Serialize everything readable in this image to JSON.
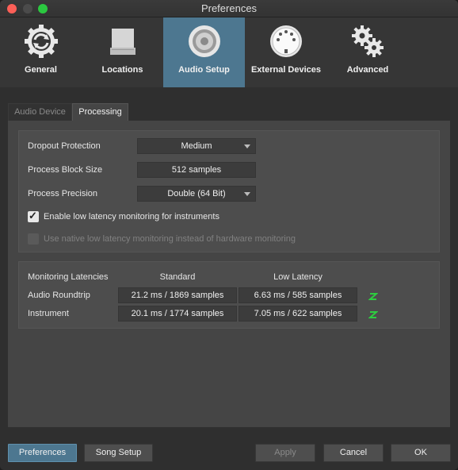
{
  "window": {
    "title": "Preferences"
  },
  "toolbar": {
    "items": [
      {
        "label": "General",
        "icon": "general-sync-icon"
      },
      {
        "label": "Locations",
        "icon": "drive-icon"
      },
      {
        "label": "Audio Setup",
        "icon": "speaker-icon",
        "active": true
      },
      {
        "label": "External Devices",
        "icon": "midi-port-icon"
      },
      {
        "label": "Advanced",
        "icon": "gears-icon"
      }
    ],
    "active_color": "#4d7790"
  },
  "tabs": [
    {
      "label": "Audio Device"
    },
    {
      "label": "Processing",
      "active": true
    }
  ],
  "processing": {
    "dropout_label": "Dropout Protection",
    "dropout_value": "Medium",
    "block_label": "Process Block Size",
    "block_value": "512 samples",
    "precision_label": "Process Precision",
    "precision_value": "Double (64 Bit)",
    "low_latency_label": "Enable low latency monitoring for instruments",
    "low_latency_checked": true,
    "native_label": "Use native low latency monitoring instead of hardware monitoring",
    "native_checked": false,
    "native_disabled": true
  },
  "latencies": {
    "header_label": "Monitoring Latencies",
    "col_standard": "Standard",
    "col_low": "Low Latency",
    "rows": [
      {
        "label": "Audio Roundtrip",
        "standard": "21.2 ms / 1869 samples",
        "low": "6.63 ms / 585 samples"
      },
      {
        "label": "Instrument",
        "standard": "20.1 ms / 1774 samples",
        "low": "7.05 ms / 622 samples"
      }
    ],
    "z_icon_color": "#2ecc40"
  },
  "buttons": {
    "preferences": "Preferences",
    "song_setup": "Song Setup",
    "apply": "Apply",
    "cancel": "Cancel",
    "ok": "OK"
  }
}
